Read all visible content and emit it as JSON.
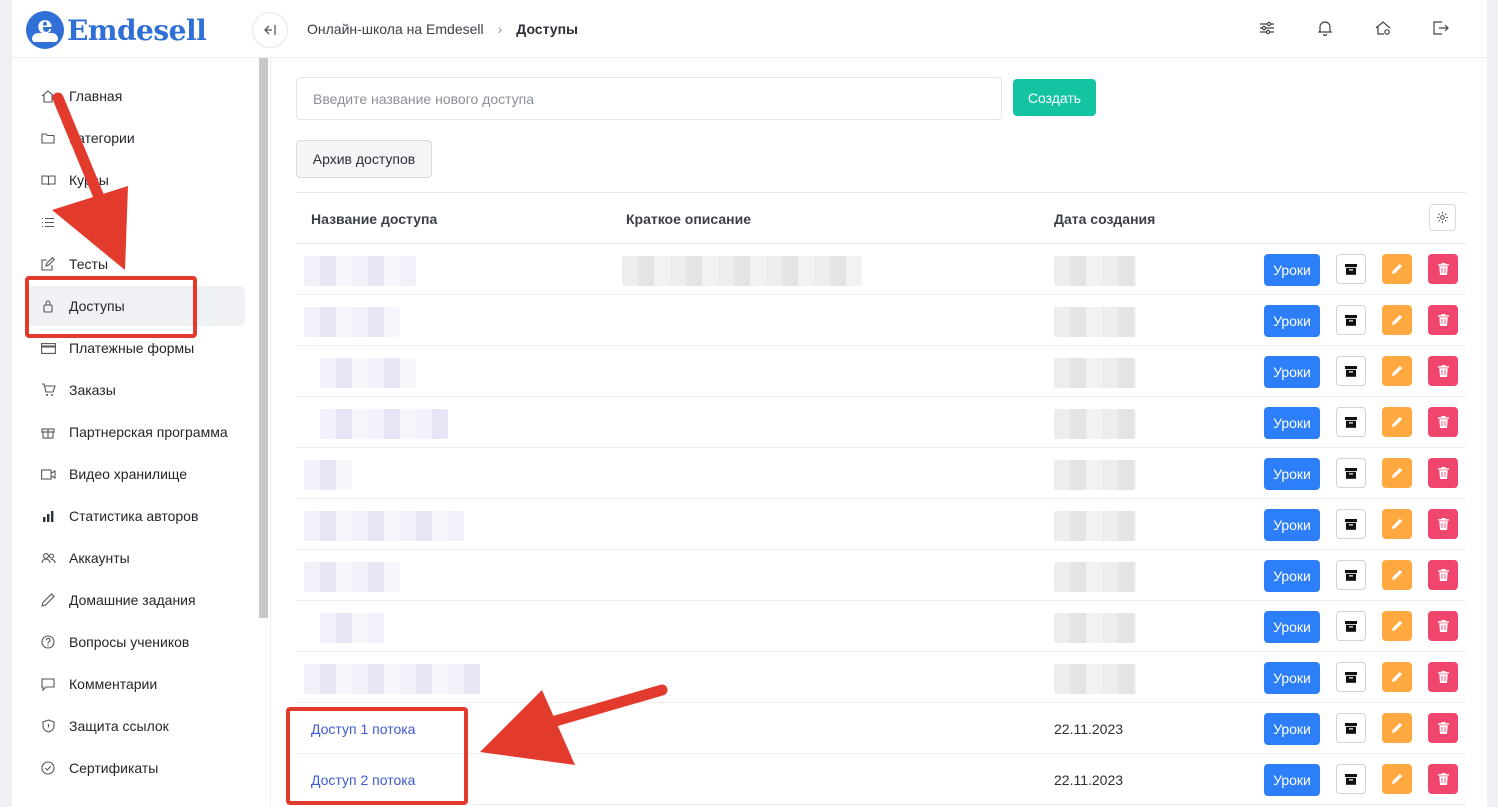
{
  "app": {
    "logo_letter": "e",
    "logo_text": "Emdesell"
  },
  "breadcrumb": {
    "root": "Онлайн-школа на Emdesell",
    "current": "Доступы"
  },
  "sidebar": {
    "items": [
      {
        "label": "Главная",
        "icon": "home-icon"
      },
      {
        "label": "Категории",
        "icon": "folder-icon"
      },
      {
        "label": "Курсы",
        "icon": "book-icon"
      },
      {
        "label": "",
        "icon": "list-icon"
      },
      {
        "label": "Тесты",
        "icon": "edit-square-icon"
      },
      {
        "label": "Доступы",
        "icon": "lock-icon",
        "active": true
      },
      {
        "label": "Платежные формы",
        "icon": "credit-card-icon"
      },
      {
        "label": "Заказы",
        "icon": "cart-icon"
      },
      {
        "label": "Партнерская программа",
        "icon": "gift-icon"
      },
      {
        "label": "Видео хранилище",
        "icon": "video-icon"
      },
      {
        "label": "Статистика авторов",
        "icon": "bar-chart-icon"
      },
      {
        "label": "Аккаунты",
        "icon": "users-icon"
      },
      {
        "label": "Домашние задания",
        "icon": "pencil-icon"
      },
      {
        "label": "Вопросы учеников",
        "icon": "question-icon"
      },
      {
        "label": "Комментарии",
        "icon": "comment-icon"
      },
      {
        "label": "Защита ссылок",
        "icon": "shield-icon"
      },
      {
        "label": "Сертификаты",
        "icon": "check-circle-icon"
      }
    ]
  },
  "form": {
    "placeholder": "Введите название нового доступа",
    "value": "",
    "create_label": "Создать",
    "archive_label": "Архив доступов"
  },
  "table": {
    "headers": {
      "name": "Название доступа",
      "description": "Краткое описание",
      "date": "Дата создания"
    },
    "action_labels": {
      "lessons": "Уроки"
    },
    "rows": [
      {
        "name": "",
        "description": "",
        "date": "",
        "blurred": true
      },
      {
        "name": "",
        "description": "",
        "date": "",
        "blurred": true
      },
      {
        "name": "",
        "description": "",
        "date": "",
        "blurred": true
      },
      {
        "name": "",
        "description": "",
        "date": "",
        "blurred": true
      },
      {
        "name": "",
        "description": "",
        "date": "",
        "blurred": true
      },
      {
        "name": "",
        "description": "",
        "date": "",
        "blurred": true
      },
      {
        "name": "",
        "description": "",
        "date": "",
        "blurred": true
      },
      {
        "name": "",
        "description": "",
        "date": "",
        "blurred": true
      },
      {
        "name": "",
        "description": "",
        "date": "",
        "blurred": true
      },
      {
        "name": "Доступ 1 потока",
        "description": "",
        "date": "22.11.2023",
        "blurred": false
      },
      {
        "name": "Доступ 2 потока",
        "description": "",
        "date": "22.11.2023",
        "blurred": false
      }
    ]
  },
  "colors": {
    "brand": "#2f6fd6",
    "create": "#13c4a3",
    "lessons": "#2d7ff9",
    "edit": "#ffa940",
    "delete": "#f0456c",
    "annotation": "#e23b2e"
  }
}
